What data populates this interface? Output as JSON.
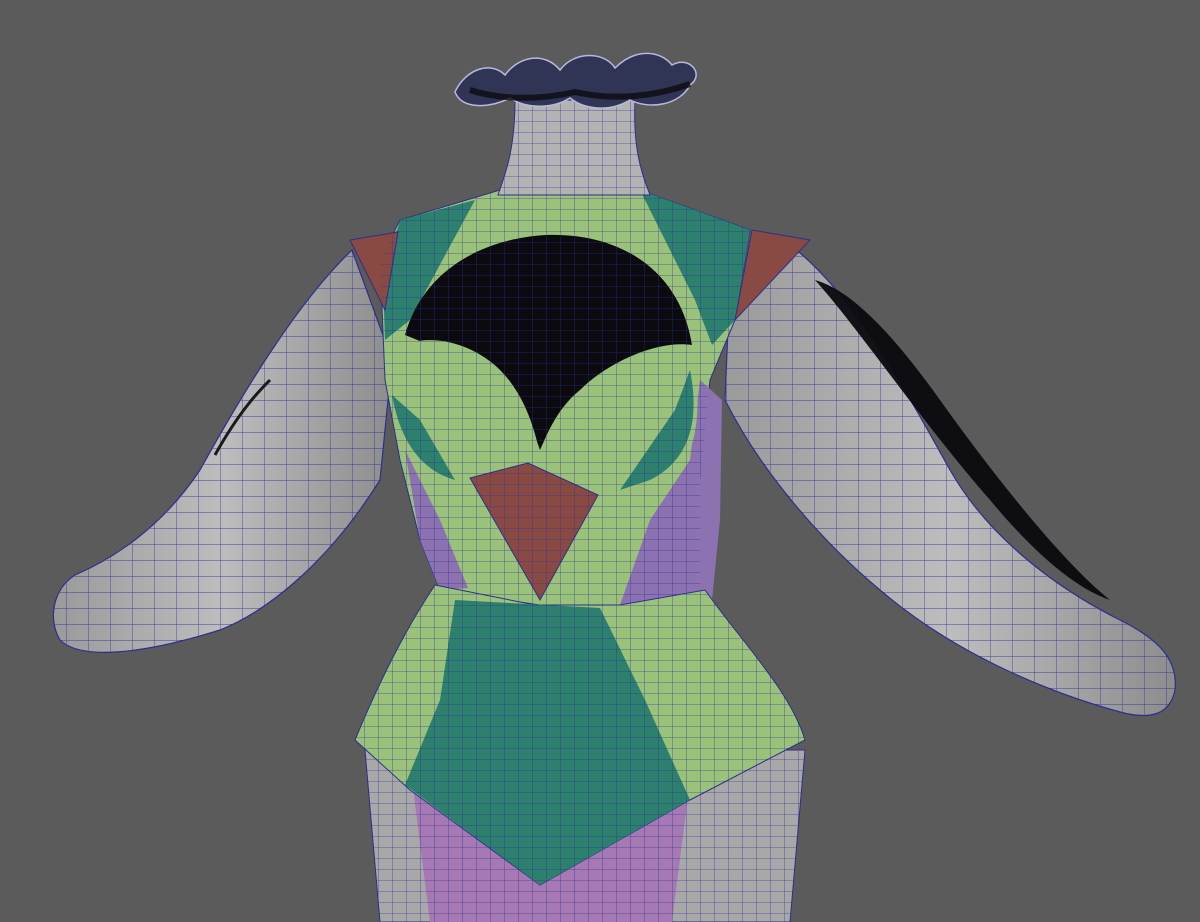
{
  "viewport": {
    "background": "#5b5b5b",
    "wire_color": "#2b2f8f"
  },
  "colors": {
    "grey": "#b3b3b3",
    "grey_dark": "#8f8f8f",
    "light_green": "#9bc27a",
    "teal": "#2d7f6e",
    "red_brown": "#8a4a44",
    "purple": "#8c72b0",
    "pink": "#a679b4",
    "black": "#0b0b0f",
    "ruffle": "#303455"
  }
}
